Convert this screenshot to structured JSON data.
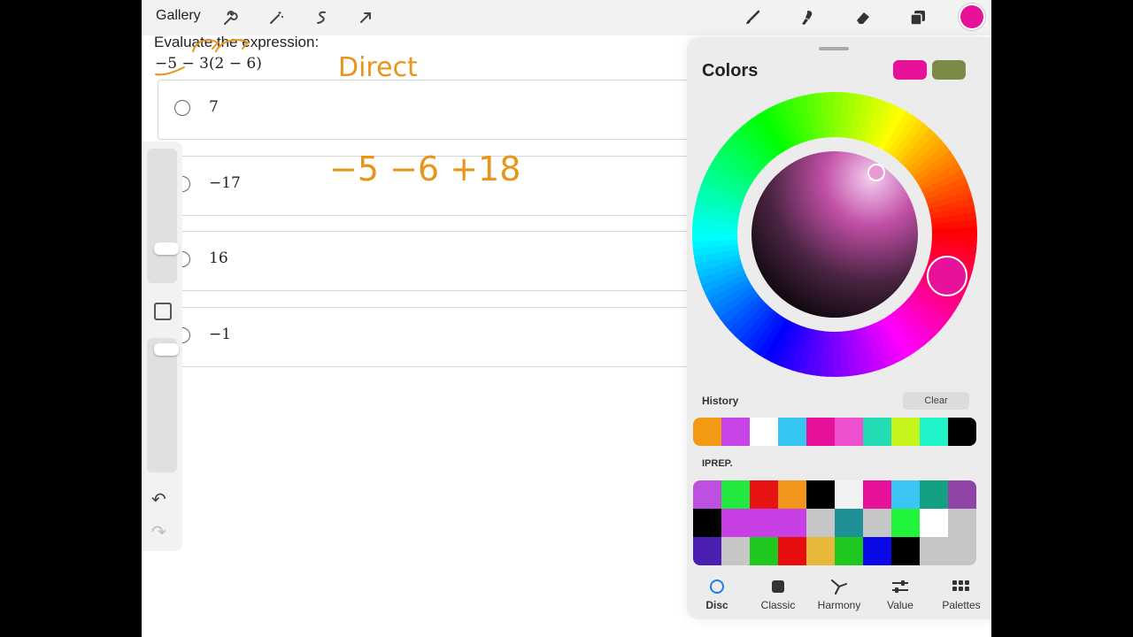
{
  "topbar": {
    "gallery_label": "Gallery",
    "left_icons": [
      "wrench-icon",
      "magic-wand-icon",
      "selection-icon",
      "transform-arrow-icon"
    ],
    "right_icons": [
      "brush-icon",
      "smudge-icon",
      "eraser-icon",
      "layers-icon"
    ],
    "current_color": "#e8119a"
  },
  "question": {
    "prompt": "Evaluate the expression:",
    "expression": "−5 − 3(2 − 6)",
    "options": [
      "7",
      "−17",
      "16",
      "−1"
    ]
  },
  "handwriting": {
    "word": "Direct",
    "work": "−5 −6 +18",
    "ink_color": "#e8951c"
  },
  "sidebar": {
    "undo_glyph": "↶",
    "redo_glyph": "↷"
  },
  "colors_panel": {
    "title": "Colors",
    "primary_color": "#e8119a",
    "secondary_color": "#7b8a44",
    "history_label": "History",
    "clear_label": "Clear",
    "history_colors": [
      "#f29a14",
      "#c944e6",
      "#ffffff",
      "#35c6f2",
      "#e8119a",
      "#ee4fce",
      "#22ddb4",
      "#c5f51c",
      "#1ff3c7",
      "#000000"
    ],
    "palette_label": "IPREP.",
    "palette_rows": [
      [
        "#bf4fe0",
        "#22e840",
        "#e81414",
        "#f2951b",
        "#000000",
        "#f2f2f2",
        "#e8119a",
        "#3ac5f5",
        "#15a083",
        "#9144a8"
      ],
      [
        "#000000",
        "#c83fe5",
        "#c83fe5",
        "#c83fe5",
        "#c6c6c6",
        "#1f9096",
        "#c6c6c6",
        "#1ff33a",
        "#ffffff",
        "#c6c6c6"
      ],
      [
        "#4a1fb0",
        "#c6c6c6",
        "#1ec81e",
        "#e80e0e",
        "#e8b83c",
        "#1ec81e",
        "#0a0ae8",
        "#000000",
        "#c6c6c6",
        "#c6c6c6"
      ]
    ],
    "tabs": [
      {
        "label": "Disc",
        "icon": "disc-icon",
        "active": true
      },
      {
        "label": "Classic",
        "icon": "classic-square-icon",
        "active": false
      },
      {
        "label": "Harmony",
        "icon": "harmony-icon",
        "active": false
      },
      {
        "label": "Value",
        "icon": "sliders-icon",
        "active": false
      },
      {
        "label": "Palettes",
        "icon": "palettes-grid-icon",
        "active": false
      }
    ],
    "accent_color": "#1a7ee8"
  }
}
